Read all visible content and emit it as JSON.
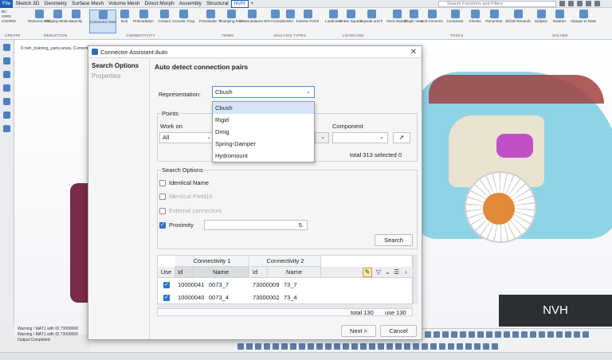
{
  "menubar": {
    "tabs": [
      "File",
      "Sketch 3D",
      "Geometry",
      "Surface Mesh",
      "Volume Mesh",
      "Direct Morph",
      "Assembly",
      "Structural",
      "NVH",
      "+"
    ],
    "search_placeholder": "Search Functions and Filters"
  },
  "ribbon": {
    "tools": [
      "Reduced Model",
      "Display Model",
      "Beamify",
      "Connector Assistant",
      "Bolt",
      "Preloadation",
      "Contact",
      "Acoustic Coupling",
      "Porcelastic Trim",
      "Damping Patch",
      "Mass Balance",
      "NVH Console",
      "SEA",
      "Inverse Forming",
      "Loadcase",
      "Brake Squeal",
      "Squeak and Rattle",
      "Deck Report",
      "Graph View",
      "Unit Conversion",
      "Compress",
      "Checks",
      "Renumber",
      "2D/3D Renumber",
      "Epilysis",
      "Nastran",
      "Abaqus to Nastran"
    ],
    "groups": [
      "Create",
      "Reduction",
      "Connectivity",
      "Trims",
      "Analysis Types",
      "Loadcase",
      "Tools",
      "Solver"
    ]
  },
  "side_labels": [
    "BC",
    "GRID",
    "COORD"
  ],
  "viewport": {
    "model_tag": "0.nvh_training_yaris.ansa, Current",
    "badge": "NVH"
  },
  "console": {
    "lines": [
      "Warning ! MAT1 with ID 73000068",
      "Warning ! MAT1 with ID 73000068",
      "Output Completed."
    ]
  },
  "dialog": {
    "title": "Connector Assistant:Auto",
    "left_pane": [
      "Search Options",
      "Properties"
    ],
    "heading": "Auto detect connection pairs",
    "representation": {
      "label": "Representation:",
      "value": "Cbush",
      "options": [
        "Cbush",
        "Rigid",
        "Dmig",
        "Spring-Damper",
        "Hydromount"
      ]
    },
    "points": {
      "title": "Points",
      "work_on_label": "Work on",
      "work_on_value": "All",
      "component_label": "Component",
      "total_text": "total 313 selected 0"
    },
    "search_options": {
      "title": "Search Options",
      "identical_name": "Identical Name",
      "identical_field": "Identical Field10",
      "external": "External connectors",
      "proximity": "Proximity",
      "proximity_value": "5.",
      "search_button": "Search"
    },
    "table": {
      "group1": "Connectivity 1",
      "group2": "Connectivity 2",
      "use_header": "Use",
      "id_header": "Id",
      "name_header": "Name",
      "rows": [
        {
          "id1": "10000041",
          "name1": "0073_7",
          "id2": "73000009",
          "name2": "73_7"
        },
        {
          "id1": "10000040",
          "name1": "0073_4",
          "id2": "73000002",
          "name2": "73_4"
        }
      ],
      "total": "total 130",
      "use": "use 130"
    },
    "next_button": "Next >",
    "cancel_button": "Cancel"
  }
}
